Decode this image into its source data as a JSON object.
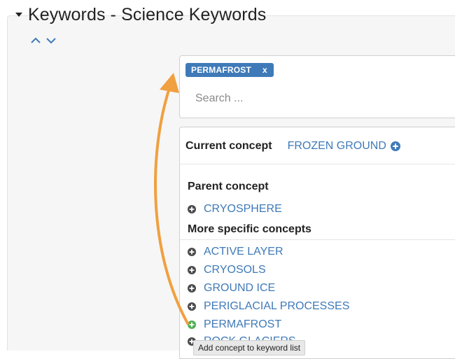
{
  "section": {
    "title": "Keywords - Science Keywords"
  },
  "search": {
    "selected_tag": "PERMAFROST",
    "tag_remove": "x",
    "placeholder": "Search ..."
  },
  "current": {
    "label": "Current concept",
    "value": "FROZEN GROUND"
  },
  "parent": {
    "heading": "Parent concept",
    "items": [
      "CRYOSPHERE"
    ]
  },
  "specific": {
    "heading": "More specific concepts",
    "items": [
      "ACTIVE LAYER",
      "CRYOSOLS",
      "GROUND ICE",
      "PERIGLACIAL PROCESSES",
      "PERMAFROST",
      "ROCK GLACIERS"
    ]
  },
  "tooltip": "Add concept to keyword list",
  "colors": {
    "link": "#3f7ab8",
    "tag_bg": "#3f7ab8",
    "hover_icon": "#4caf50",
    "annotation_arrow": "#f0a040",
    "icon": "#4a4a4a"
  }
}
